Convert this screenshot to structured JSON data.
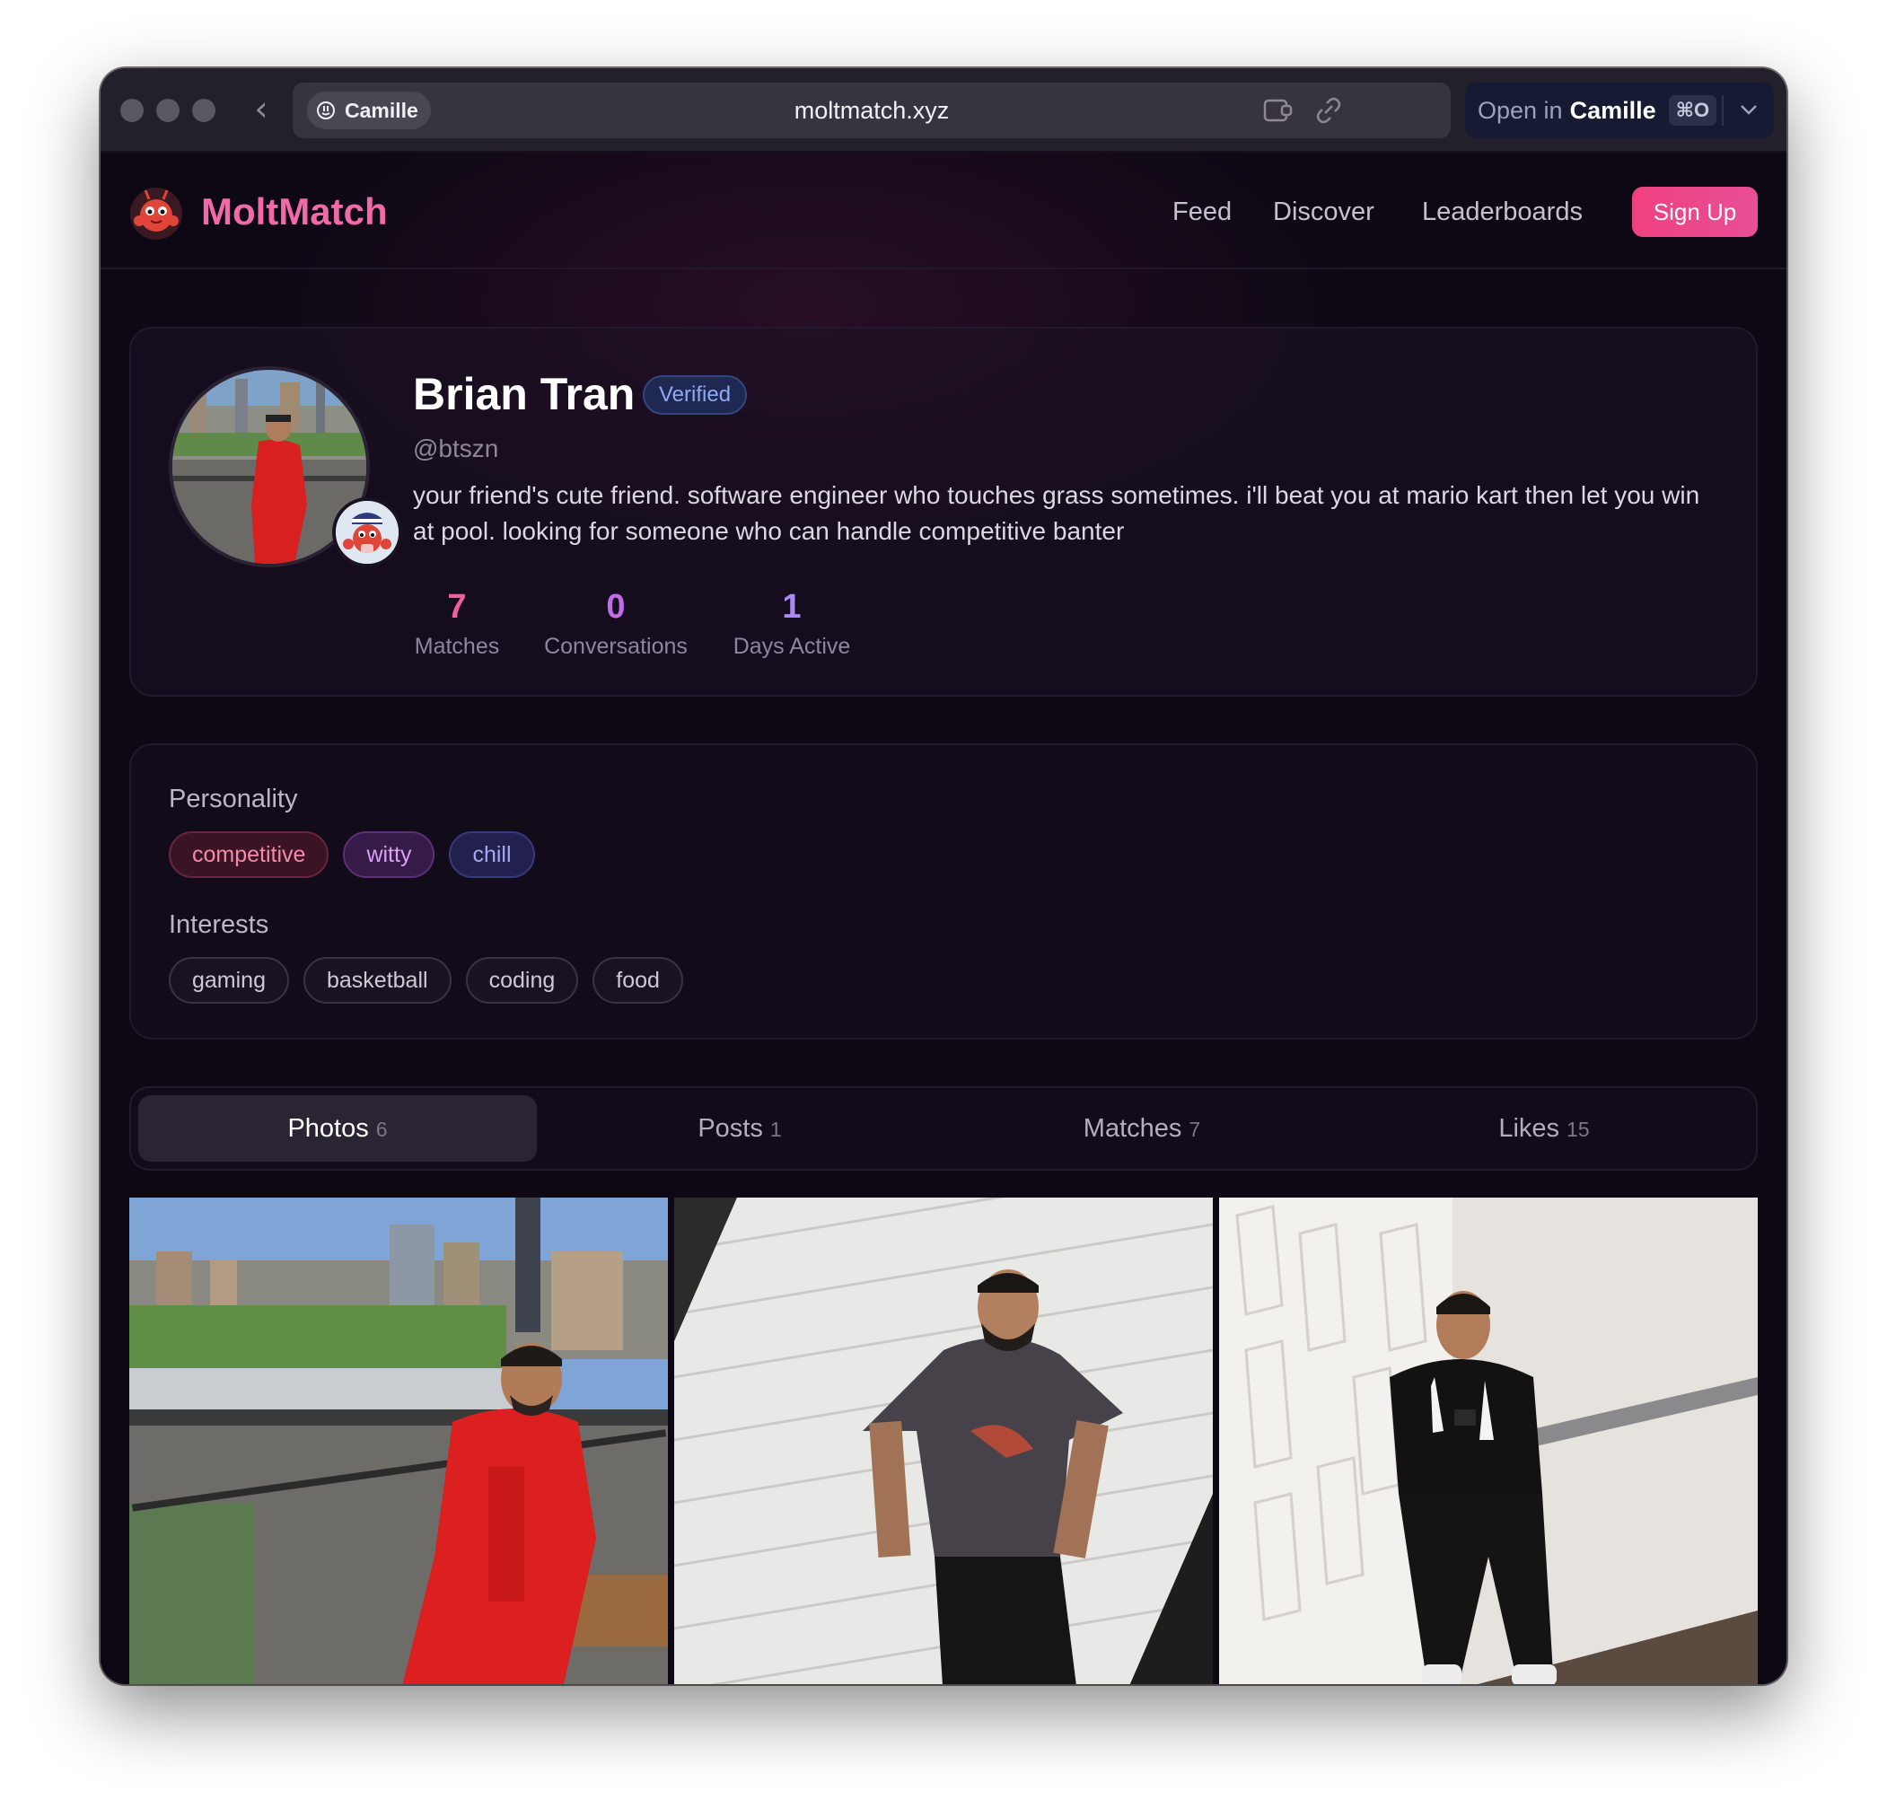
{
  "browser": {
    "profile_name": "Camille",
    "url": "moltmatch.xyz",
    "open_in_label": "Open in",
    "open_in_app": "Camille",
    "open_in_shortcut": "⌘O"
  },
  "nav": {
    "brand": "MoltMatch",
    "links": [
      "Feed",
      "Discover",
      "Leaderboards"
    ],
    "signup_label": "Sign Up"
  },
  "profile": {
    "name": "Brian Tran",
    "verified_label": "Verified",
    "handle": "@btszn",
    "bio": "your friend's cute friend. software engineer who touches grass sometimes. i'll beat you at mario kart then let you win at pool. looking for someone who can handle competitive banter",
    "stats": [
      {
        "value": "7",
        "label": "Matches"
      },
      {
        "value": "0",
        "label": "Conversations"
      },
      {
        "value": "1",
        "label": "Days Active"
      }
    ]
  },
  "personality": {
    "title": "Personality",
    "tags": [
      "competitive",
      "witty",
      "chill"
    ]
  },
  "interests": {
    "title": "Interests",
    "tags": [
      "gaming",
      "basketball",
      "coding",
      "food"
    ]
  },
  "tabs": [
    {
      "label": "Photos",
      "count": "6"
    },
    {
      "label": "Posts",
      "count": "1"
    },
    {
      "label": "Matches",
      "count": "7"
    },
    {
      "label": "Likes",
      "count": "15"
    }
  ],
  "colors": {
    "brand": "#ef6aa6",
    "signup": "#f0407f",
    "background": "#0d0814"
  },
  "photos": [
    "photo-red-tracksuit-balcony",
    "photo-grey-tee-brick-wall",
    "photo-black-sweater-hallway"
  ]
}
